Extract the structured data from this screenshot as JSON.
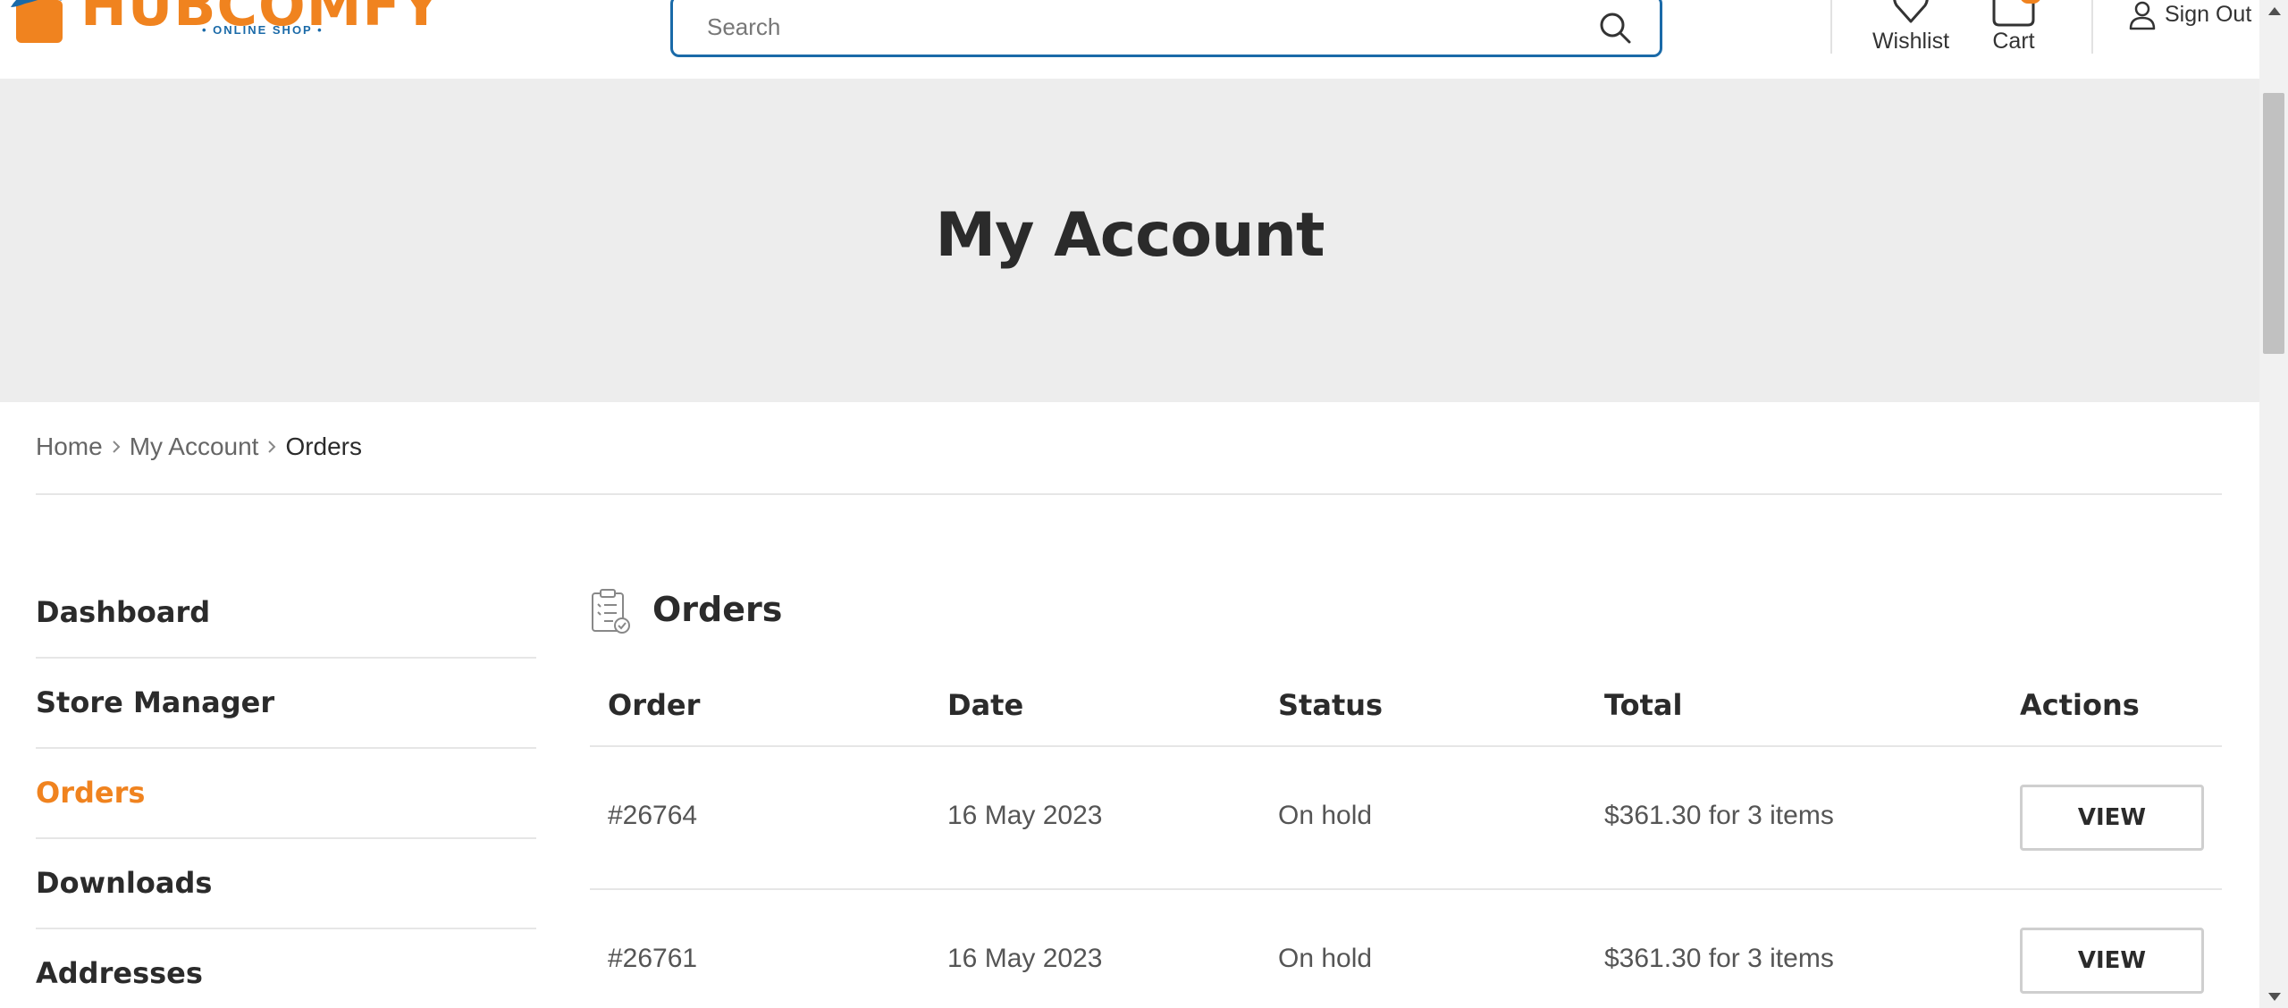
{
  "header": {
    "logo_text": "HUBCOMFY",
    "logo_tagline": "• ONLINE SHOP •",
    "search_placeholder": "Search",
    "wishlist_label": "Wishlist",
    "cart_label": "Cart",
    "signout_label": "Sign Out"
  },
  "colors": {
    "brand_orange": "#f0831f",
    "brand_blue": "#1a6aa8",
    "banner_bg": "#ededed"
  },
  "banner": {
    "title": "My Account"
  },
  "breadcrumb": {
    "items": [
      "Home",
      "My Account",
      "Orders"
    ]
  },
  "sidebar": {
    "items": [
      {
        "label": "Dashboard",
        "active": false
      },
      {
        "label": "Store Manager",
        "active": false
      },
      {
        "label": "Orders",
        "active": true
      },
      {
        "label": "Downloads",
        "active": false
      },
      {
        "label": "Addresses",
        "active": false
      }
    ]
  },
  "orders": {
    "title": "Orders",
    "columns": [
      "Order",
      "Date",
      "Status",
      "Total",
      "Actions"
    ],
    "rows": [
      {
        "order": "#26764",
        "date": "16 May 2023",
        "status": "On hold",
        "total": "$361.30 for 3 items",
        "action": "VIEW"
      },
      {
        "order": "#26761",
        "date": "16 May 2023",
        "status": "On hold",
        "total": "$361.30 for 3 items",
        "action": "VIEW"
      }
    ]
  }
}
